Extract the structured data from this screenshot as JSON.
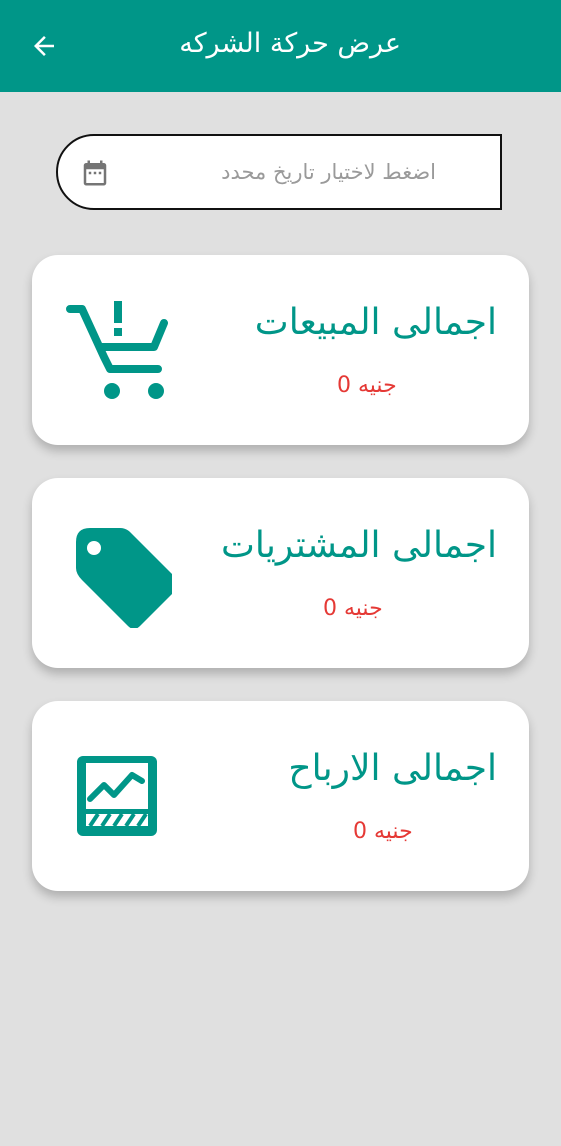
{
  "appbar": {
    "title": "عرض حركة الشركه",
    "back_icon": "arrow-back-icon"
  },
  "date_picker": {
    "label": "اضغط لاختيار تاريخ محدد",
    "icon": "calendar-icon"
  },
  "cards": [
    {
      "title": "اجمالى المبيعات",
      "amount": "جنيه 0",
      "icon": "shopping-cart-icon"
    },
    {
      "title": "اجمالى المشتريات",
      "amount": "جنيه 0",
      "icon": "tag-icon"
    },
    {
      "title": "اجمالى الارباح",
      "amount": "جنيه 0",
      "icon": "profit-chart-icon"
    }
  ],
  "colors": {
    "primary": "#009688",
    "background": "#e0e0e0",
    "amount": "#e53935",
    "hint": "#9a9a9a"
  }
}
